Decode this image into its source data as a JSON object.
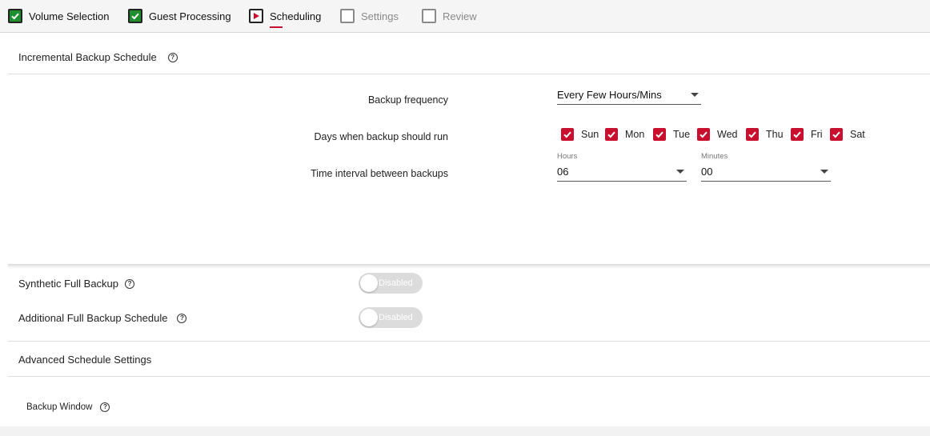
{
  "wizard": {
    "steps": [
      {
        "label": "Volume Selection",
        "state": "done"
      },
      {
        "label": "Guest Processing",
        "state": "done"
      },
      {
        "label": "Scheduling",
        "state": "active"
      },
      {
        "label": "Settings",
        "state": "todo"
      },
      {
        "label": "Review",
        "state": "todo"
      }
    ]
  },
  "incremental": {
    "title": "Incremental Backup Schedule",
    "help": "?",
    "frequency": {
      "label": "Backup frequency",
      "value": "Every Few Hours/Mins"
    },
    "days": {
      "label": "Days when backup should run",
      "items": [
        {
          "label": "Sun",
          "checked": true
        },
        {
          "label": "Mon",
          "checked": true
        },
        {
          "label": "Tue",
          "checked": true
        },
        {
          "label": "Wed",
          "checked": true
        },
        {
          "label": "Thu",
          "checked": true
        },
        {
          "label": "Fri",
          "checked": true
        },
        {
          "label": "Sat",
          "checked": true
        }
      ]
    },
    "interval": {
      "label": "Time interval between backups",
      "hours_caption": "Hours",
      "hours_value": "06",
      "minutes_caption": "Minutes",
      "minutes_value": "00"
    }
  },
  "synthetic": {
    "title": "Synthetic Full Backup",
    "help": "?",
    "toggle_label": "Disabled",
    "enabled": false
  },
  "additional": {
    "title": "Additional Full Backup Schedule",
    "help": "?",
    "toggle_label": "Disabled",
    "enabled": false
  },
  "advanced": {
    "title": "Advanced Schedule Settings"
  },
  "backup_window": {
    "title": "Backup Window",
    "help": "?"
  },
  "colors": {
    "accent": "#c8102e",
    "done": "#1e8e2e",
    "toggle_off": "#dcdcdc"
  },
  "icons": {
    "done": "checkmark-icon",
    "active": "play-icon",
    "help": "help-circle-icon",
    "dropdown": "caret-down-icon"
  }
}
